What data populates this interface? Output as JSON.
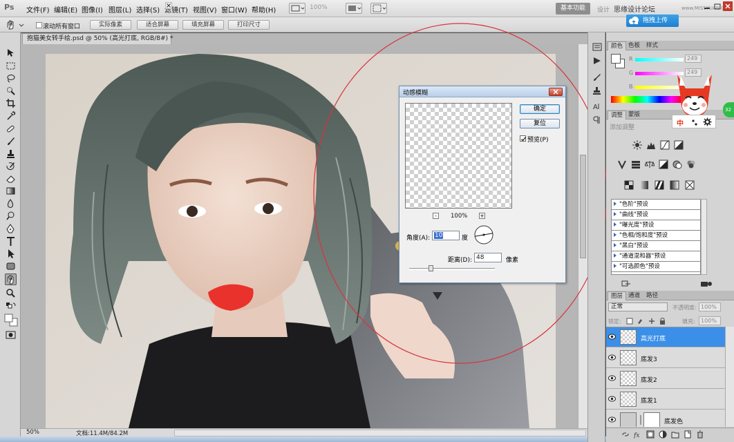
{
  "app": {
    "logo": "Ps"
  },
  "menu": {
    "items": [
      "文件(F)",
      "编辑(E)",
      "图像(I)",
      "图层(L)",
      "选择(S)",
      "滤镜(T)",
      "视图(V)",
      "窗口(W)",
      "帮助(H)"
    ],
    "zoom": "100%",
    "workspace_active": "基本功能",
    "workspace_design": "设计",
    "watermark": "思缘设计论坛",
    "watermark_url": "www.MISSYUAN.COM"
  },
  "options_bar": {
    "scroll_all_label": "滚动所有窗口",
    "buttons": [
      "实际像素",
      "适合屏幕",
      "填充屏幕",
      "打印尺寸"
    ],
    "upload_label": "拖拽上传"
  },
  "document": {
    "tab_title": "抱猫美女转手绘.psd @ 50% (高光打底, RGB/8#) *",
    "zoom_status": "50%",
    "doc_info": "文档:11.4M/84.2M"
  },
  "dialog": {
    "title": "动感模糊",
    "ok_label": "确定",
    "reset_label": "复位",
    "preview_label": "预览(P)",
    "preview_checked": true,
    "preview_zoom": "100%",
    "zoom_minus": "-",
    "zoom_plus": "+",
    "angle_label": "角度(A):",
    "angle_value": "10",
    "angle_unit": "度",
    "distance_label": "距离(D):",
    "distance_value": "48",
    "distance_unit": "像素"
  },
  "color_panel": {
    "tabs": [
      "颜色",
      "色板",
      "样式"
    ],
    "rows": [
      {
        "label": "R",
        "value": "249"
      },
      {
        "label": "G",
        "value": "249"
      },
      {
        "label": "B",
        "value": ""
      }
    ]
  },
  "adjustments_panel": {
    "tabs": [
      "调整",
      "蒙版"
    ],
    "title": "添加调整",
    "presets": [
      "\"色阶\"预设",
      "\"曲线\"预设",
      "\"曝光度\"预设",
      "\"色相/饱和度\"预设",
      "\"黑白\"预设",
      "\"通道混和器\"预设",
      "\"可选颜色\"预设"
    ]
  },
  "mascot_toolbar": {
    "label_zh": "中"
  },
  "green_tab": {
    "label": "32"
  },
  "layers_panel": {
    "tabs": [
      "图层",
      "通道",
      "路径"
    ],
    "blend_mode": "正常",
    "opacity_label": "不透明度:",
    "opacity_value": "100%",
    "lock_label": "锁定:",
    "fill_label": "填充:",
    "fill_value": "100%",
    "layers": [
      {
        "name": "高光打底",
        "selected": true
      },
      {
        "name": "底发3",
        "selected": false
      },
      {
        "name": "底发2",
        "selected": false
      },
      {
        "name": "底发1",
        "selected": false
      },
      {
        "name": "底发色",
        "selected": false
      }
    ]
  },
  "colors": {
    "accent_selected_layer": "#3b8fe8",
    "upload_button": "#1f7fcf",
    "circle_annotation": "#d8333f",
    "lips": "#e8322b"
  }
}
